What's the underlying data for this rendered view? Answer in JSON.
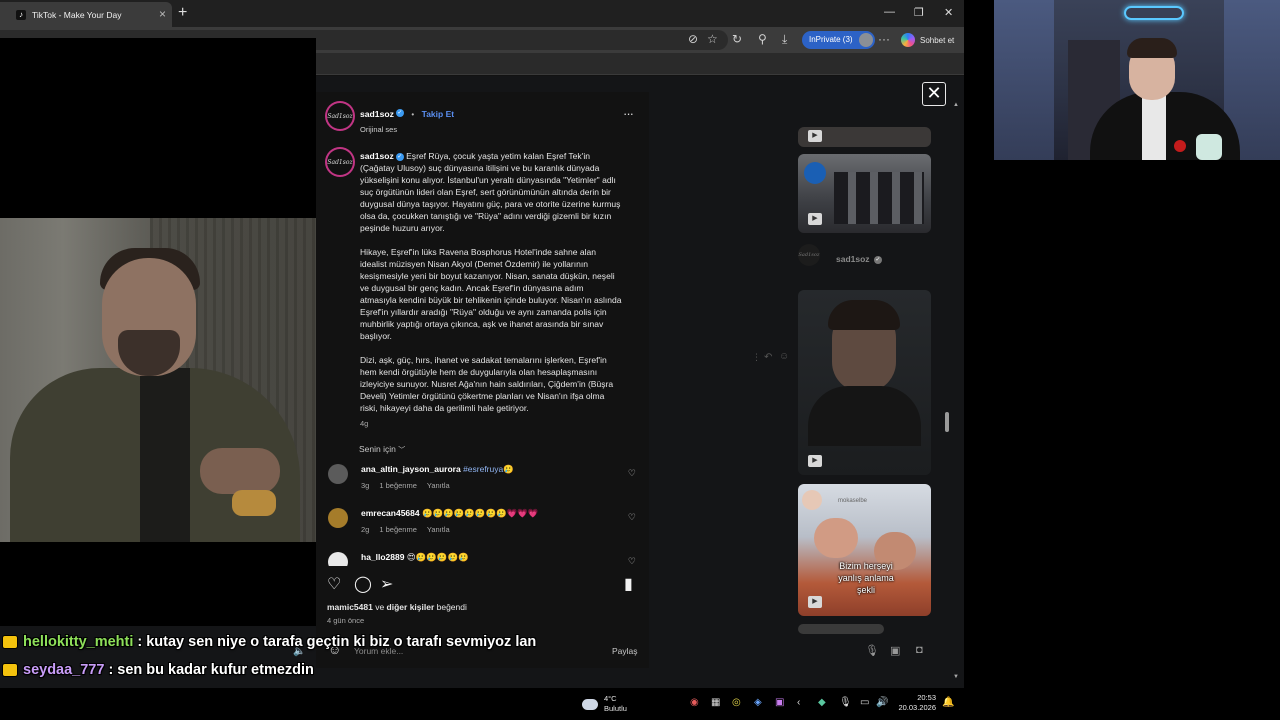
{
  "browser": {
    "tab_title": "TikTok - Make Your Day",
    "inprivate_label": "InPrivate (3)",
    "copilot_label": "Sohbet et"
  },
  "post": {
    "username": "sad1soz",
    "follow_label": "Takip Et",
    "sound_label": "Orijinal ses",
    "caption_user": "sad1soz",
    "caption_p1": "Eşref Rüya, çocuk yaşta yetim kalan Eşref Tek'in (Çağatay Ulusoy) suç dünyasına itilişini ve bu karanlık dünyada yükselişini konu alıyor. İstanbul'un yeraltı dünyasında \"Yetimler\" adlı suç örgütünün lideri olan Eşref, sert görünümünün altında derin bir duygusal dünya taşıyor. Hayatını güç, para ve otorite üzerine kurmuş olsa da, çocukken tanıştığı ve \"Rüya\" adını verdiği gizemli bir kızın peşinde huzuru arıyor.",
    "caption_p2": "Hikaye, Eşref'in lüks Ravena Bosphorus Hotel'inde sahne alan idealist müzisyen Nisan Akyol (Demet Özdemir) ile yollarının kesişmesiyle yeni bir boyut kazanıyor. Nisan, sanata düşkün, neşeli ve duygusal bir genç kadın. Ancak Eşref'in dünyasına adım atmasıyla kendini büyük bir tehlikenin içinde buluyor. Nisan'ın aslında Eşref'in yıllardır aradığı \"Rüya\" olduğu ve aynı zamanda polis için muhbirlik yaptığı ortaya çıkınca, aşk ve ihanet arasında bir sınav başlıyor.",
    "caption_p3": "Dizi, aşk, güç, hırs, ihanet ve sadakat temalarını işlerken, Eşref'in hem kendi örgütüyle hem de duygularıyla olan hesaplaşmasını izleyiciye sunuyor. Nusret Ağa'nın hain saldırıları, Çiğdem'in (Büşra Develi) Yetimler örgütünü çökertme planları ve Nisan'ın ifşa olma riski, hikayeyi daha da gerilimli hale getiriyor.",
    "caption_age": "4g",
    "sort_label": "Senin için",
    "likes_prefix": "mamic5481",
    "likes_middle": " ve ",
    "likes_suffix": "diğer kişiler",
    "likes_tail": " beğendi",
    "post_age": "4 gün önce",
    "comment_placeholder": "Yorum ekle...",
    "share_label": "Paylaş",
    "avatar_text": "Sad1soz"
  },
  "comments": [
    {
      "user": "ana_altin_jayson_aurora",
      "text": "#esrefruya",
      "emoji": "🥲",
      "age": "3g",
      "likes": "1 beğenme",
      "reply": "Yanıtla"
    },
    {
      "user": "emrecan45684",
      "text": "",
      "emoji": "🥲🥲🥲🥲🥲🥲🥲🥲💗💗💗",
      "age": "2g",
      "likes": "1 beğenme",
      "reply": "Yanıtla"
    },
    {
      "user": "ha_llo2889",
      "text": "",
      "emoji": "😍🥲🥲🥲🥲🥲",
      "age": "",
      "likes": "",
      "reply": ""
    }
  ],
  "related": {
    "creator": "sad1soz",
    "thumb_overlay_text": "Bizim herşeyi yanlış anlama şekli",
    "thumb_watermark": "mokaselbe"
  },
  "chat": [
    {
      "user": "hellokitty_mehti",
      "user_color": "#8ee05a",
      "message": ": kutay sen niye o tarafa geçtin ki biz o tarafı sevmiyoz lan"
    },
    {
      "user": "seydaa_777",
      "user_color": "#c89cf7",
      "message": ": sen bu kadar kufur etmezdin"
    }
  ],
  "taskbar": {
    "temp": "4°C",
    "weather_desc": "Bulutlu",
    "time": "20:53",
    "date": "20.03.2026"
  }
}
